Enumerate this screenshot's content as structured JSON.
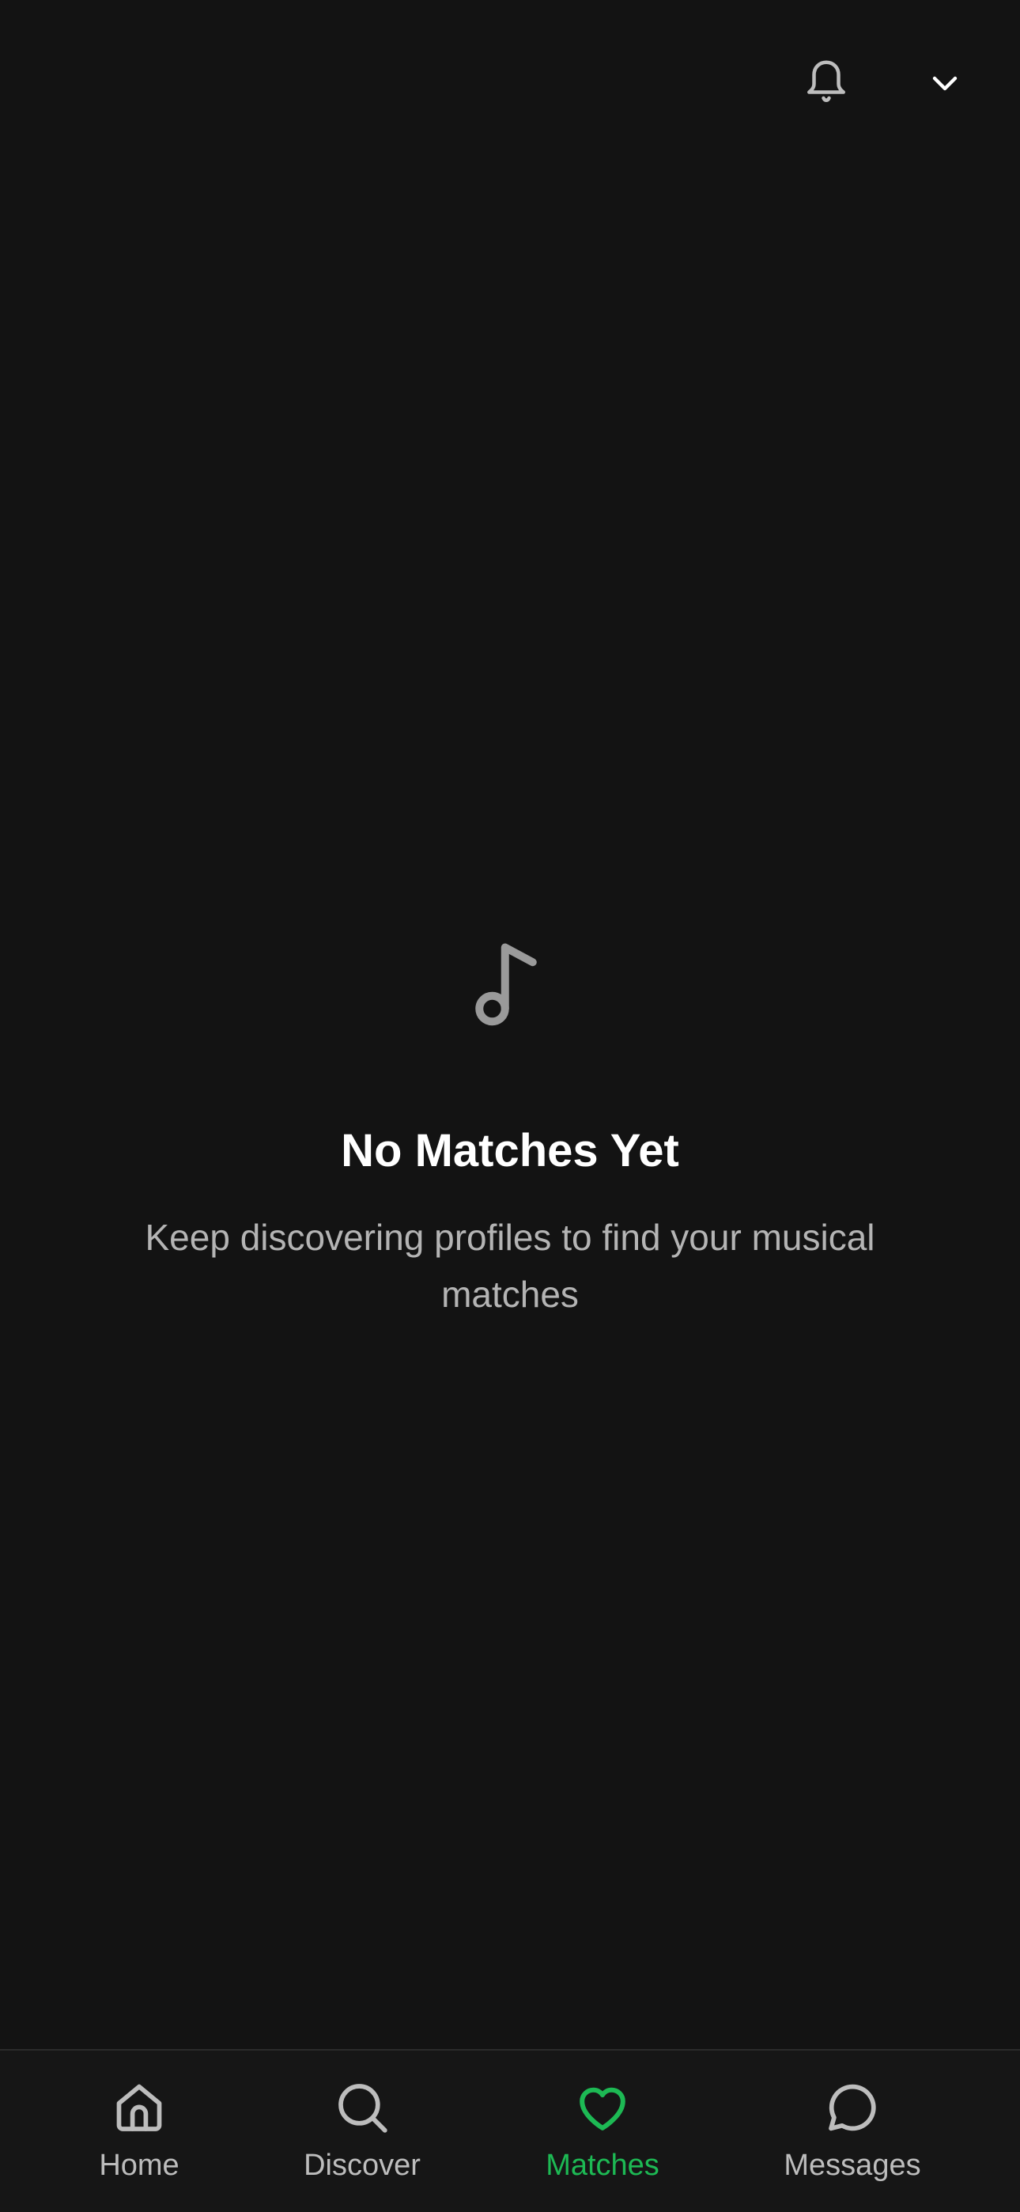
{
  "header": {
    "notifications_icon": "bell-icon",
    "account_icon": "chevron-down-icon"
  },
  "empty_state": {
    "icon": "music-note-icon",
    "title": "No Matches Yet",
    "subtitle": "Keep discovering profiles to find your musical matches"
  },
  "bottom_nav": {
    "active_tab": "Matches",
    "items": [
      {
        "label": "Home",
        "icon": "home-icon"
      },
      {
        "label": "Discover",
        "icon": "search-icon"
      },
      {
        "label": "Matches",
        "icon": "heart-icon"
      },
      {
        "label": "Messages",
        "icon": "chat-bubble-icon"
      }
    ]
  },
  "colors": {
    "background": "#131313",
    "accent": "#1db954",
    "text_primary": "#ffffff",
    "text_secondary": "#b4b4b4",
    "icon_muted": "#9a9a9a"
  }
}
